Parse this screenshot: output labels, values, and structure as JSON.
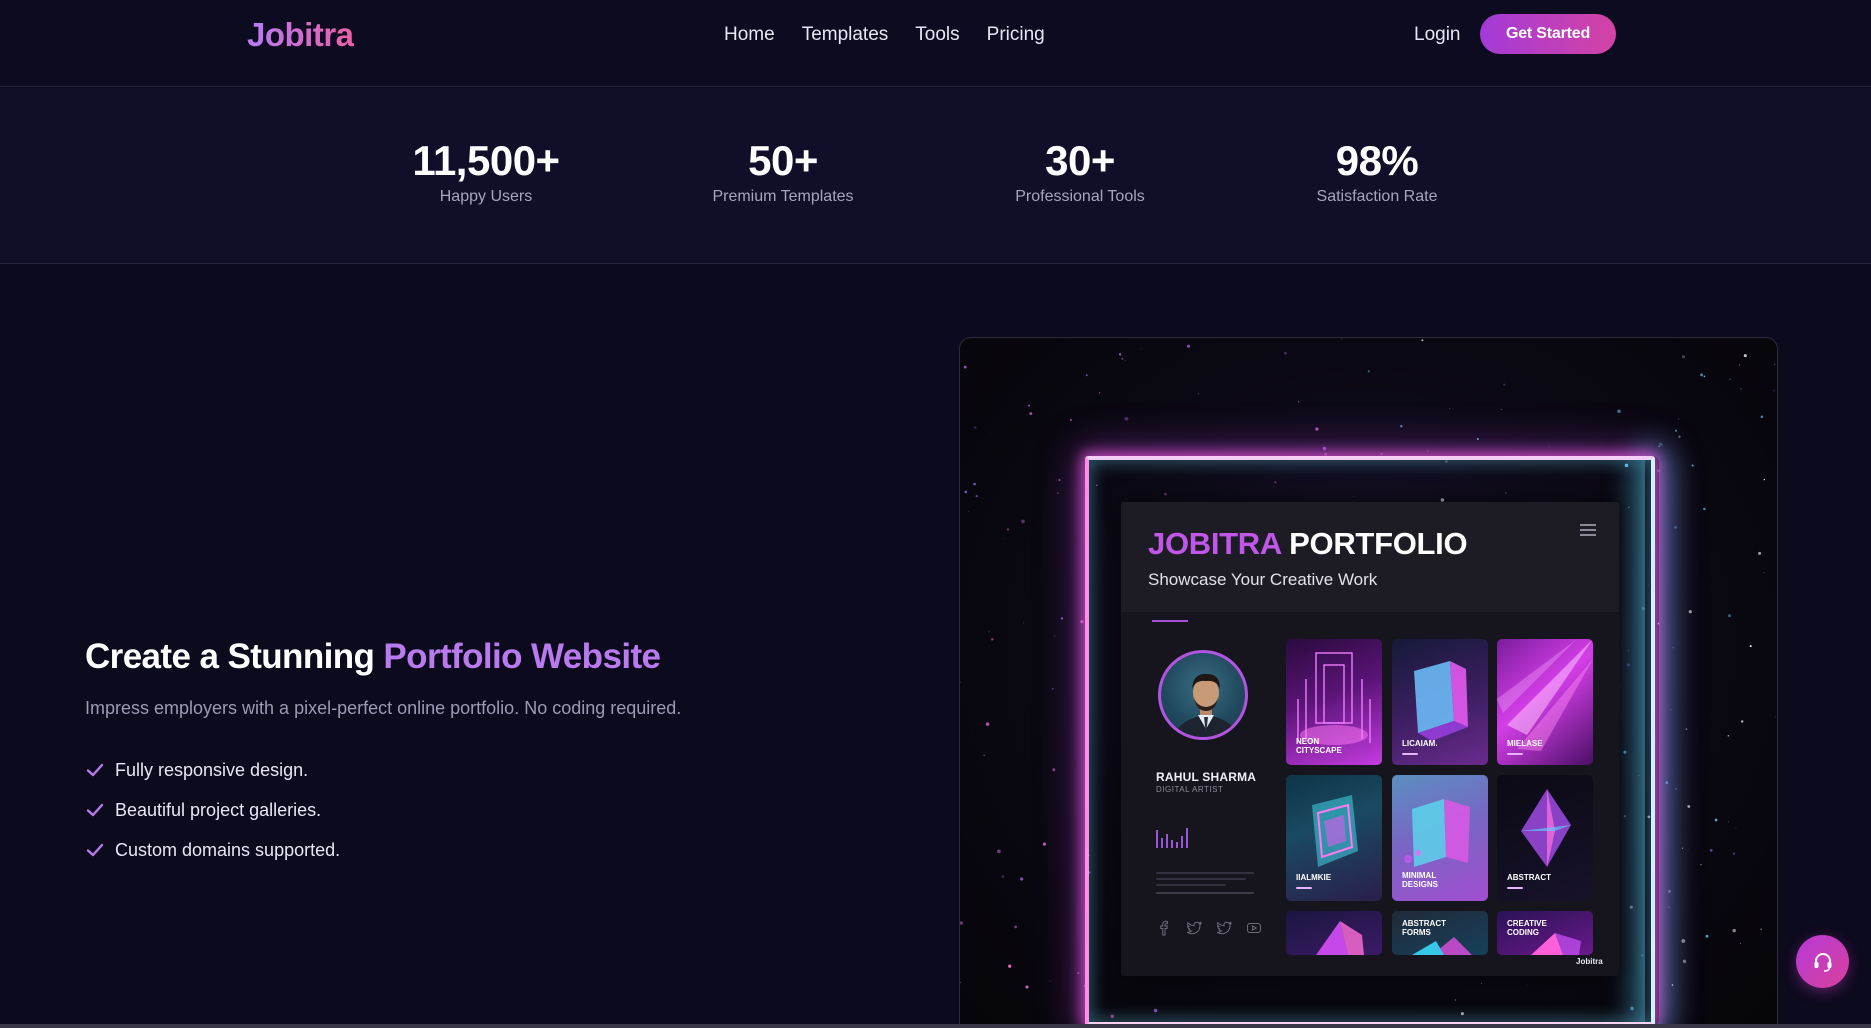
{
  "nav": {
    "brand": "Jobitra",
    "links": [
      "Home",
      "Templates",
      "Tools",
      "Pricing"
    ],
    "login": "Login",
    "cta": "Get Started"
  },
  "stats": [
    {
      "value": "11,500+",
      "label": "Happy Users"
    },
    {
      "value": "50+",
      "label": "Premium Templates"
    },
    {
      "value": "30+",
      "label": "Professional Tools"
    },
    {
      "value": "98%",
      "label": "Satisfaction Rate"
    }
  ],
  "hero": {
    "title_prefix": "Create a Stunning ",
    "title_highlight": "Portfolio Website",
    "subtitle": "Impress employers with a pixel-perfect online portfolio. No coding required.",
    "features": [
      "Fully responsive design.",
      "Beautiful project galleries.",
      "Custom domains supported."
    ]
  },
  "showcase": {
    "title_part1": "JOBITRA",
    "title_part2": "PORTFOLIO",
    "tagline": "Showcase Your Creative Work",
    "profile_name": "RAHUL SHARMA",
    "profile_role": "DIGITAL ARTIST",
    "tiles": [
      {
        "label": "NEON\nCITYSCAPE"
      },
      {
        "label": "LICAIAM."
      },
      {
        "label": "MIELASE"
      },
      {
        "label": "IIALMKIE"
      },
      {
        "label": "MINIMAL\nDESIGNS"
      },
      {
        "label": "ABSTRACT"
      },
      {
        "label": "ABSTRACT\nFORMS"
      },
      {
        "label": "CREATIVE\nCODING"
      }
    ],
    "watermark": "Jobitra"
  },
  "colors": {
    "background": "#0c0a1d",
    "accent_purple": "#b97af0",
    "cta_gradient_start": "#a33ad8",
    "cta_gradient_end": "#d443a4",
    "neon_pink": "#e958e0",
    "neon_cyan": "#5ad2ff"
  },
  "icons": {
    "check": "check-icon",
    "support": "headset-icon",
    "menu": "hamburger-icon",
    "socials": [
      "facebook-icon",
      "twitter-icon",
      "twitter-icon",
      "youtube-icon"
    ]
  }
}
